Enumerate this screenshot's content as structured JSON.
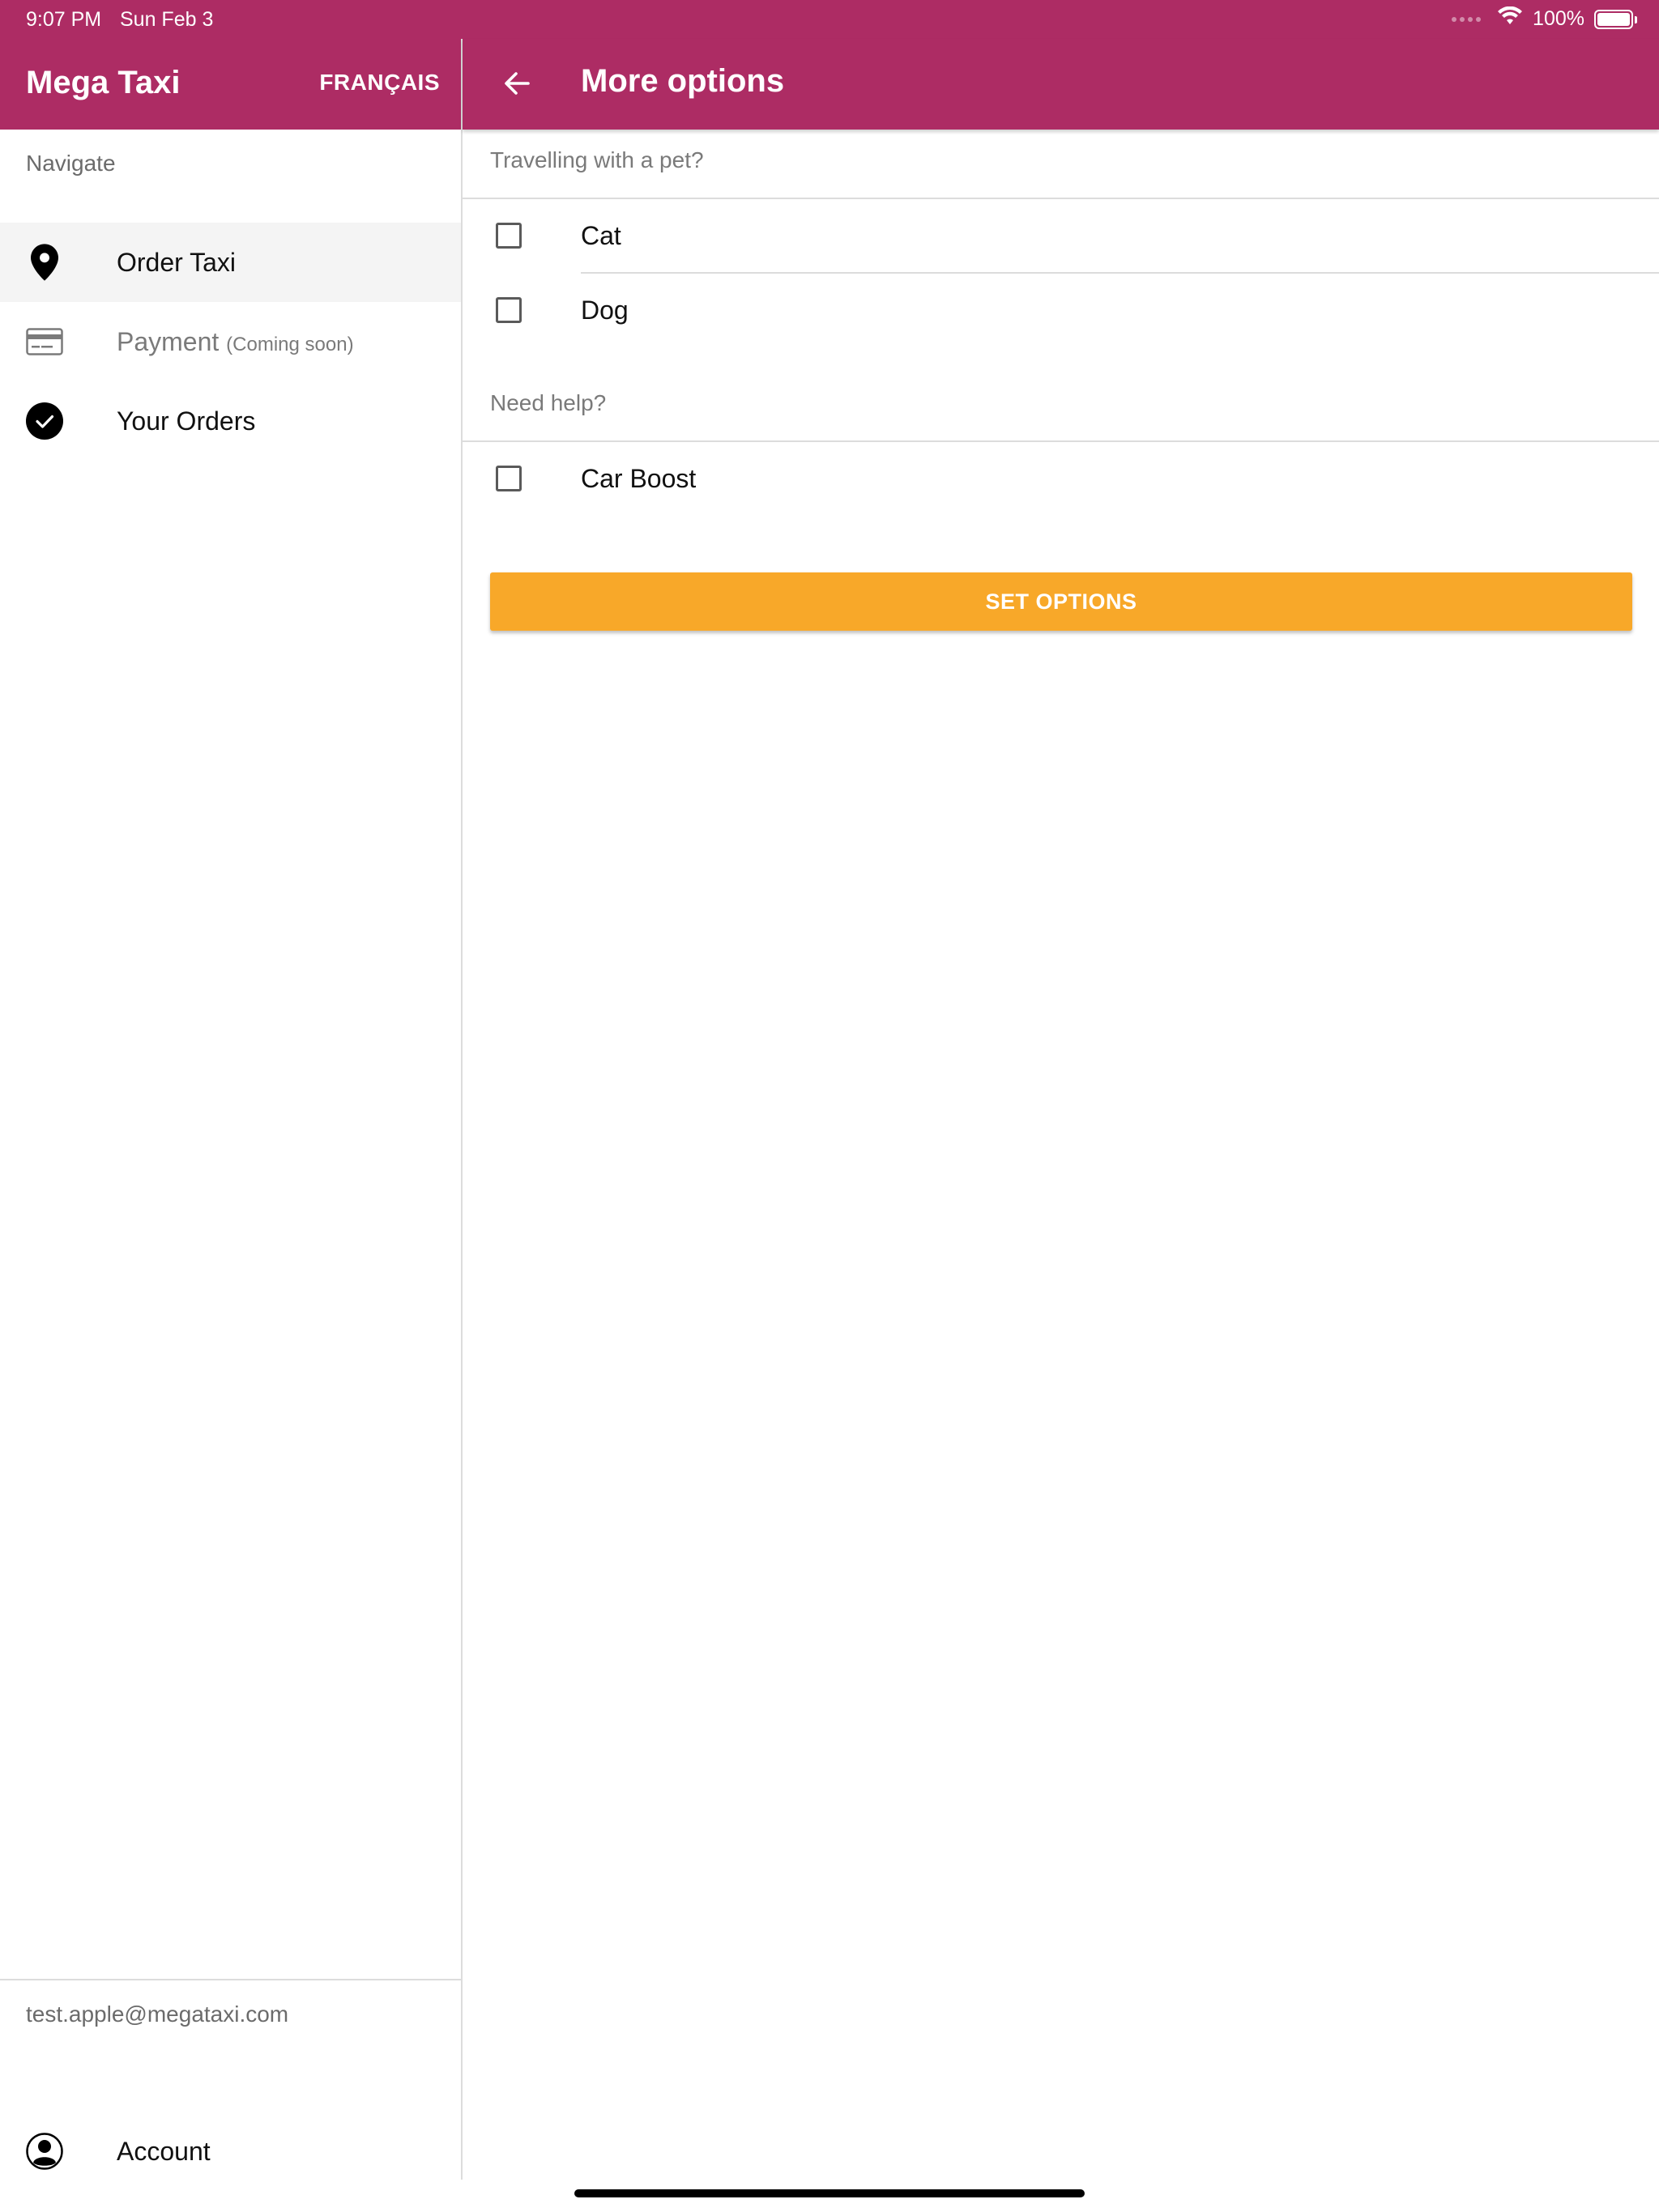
{
  "status_bar": {
    "time": "9:07 PM",
    "date": "Sun Feb 3",
    "battery": "100%"
  },
  "drawer": {
    "app_title": "Mega Taxi",
    "language_button": "FRANÇAIS",
    "section_label": "Navigate",
    "items": [
      {
        "label": "Order Taxi",
        "icon": "location-pin-icon",
        "active": true
      },
      {
        "label": "Payment",
        "note": "(Coming soon)",
        "icon": "credit-card-icon",
        "disabled": true
      },
      {
        "label": "Your Orders",
        "icon": "check-circle-icon"
      }
    ],
    "email": "test.apple@megataxi.com",
    "account_label": "Account"
  },
  "pane": {
    "title": "More options",
    "pet_section_label": "Travelling with a pet?",
    "pet_options": [
      {
        "label": "Cat",
        "checked": false
      },
      {
        "label": "Dog",
        "checked": false
      }
    ],
    "help_section_label": "Need help?",
    "help_options": [
      {
        "label": "Car Boost",
        "checked": false
      }
    ],
    "set_button": "SET OPTIONS"
  },
  "colors": {
    "primary": "#ad2c64",
    "accent": "#f8a829"
  }
}
